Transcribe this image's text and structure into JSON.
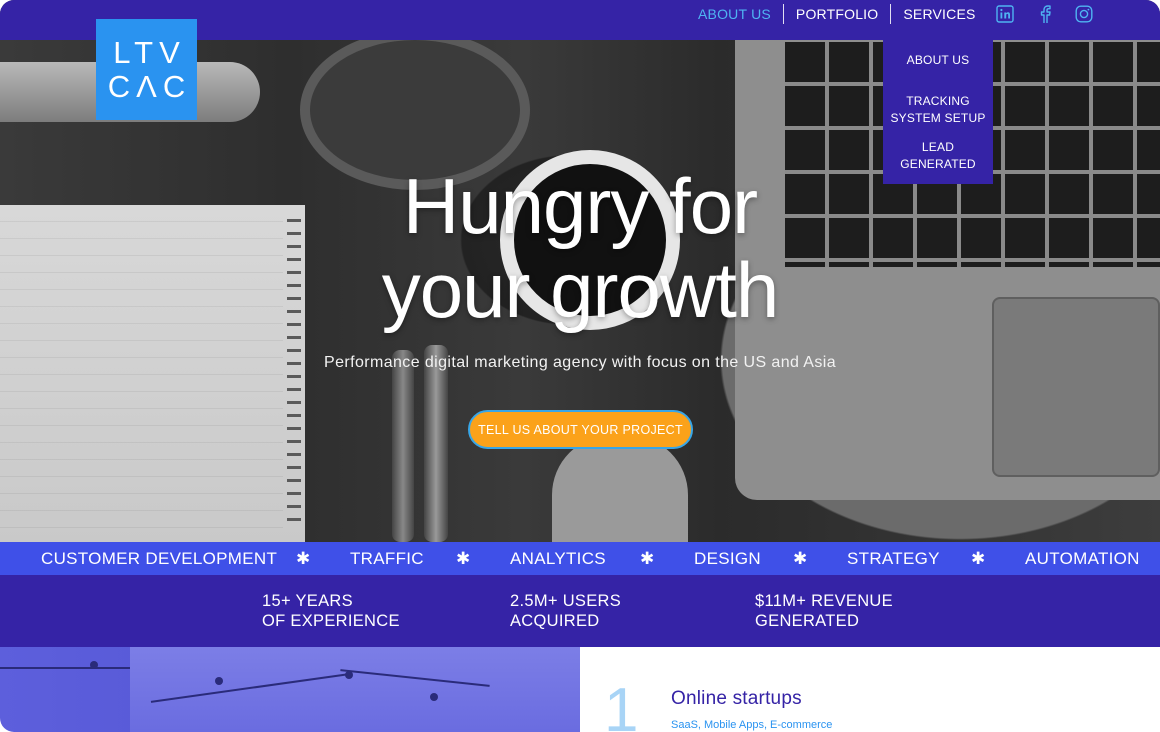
{
  "nav": {
    "items": [
      {
        "label": "ABOUT US",
        "active": true
      },
      {
        "label": "PORTFOLIO",
        "active": false
      },
      {
        "label": "SERVICES",
        "active": false
      }
    ],
    "social": [
      "linkedin-icon",
      "facebook-icon",
      "instagram-icon"
    ]
  },
  "logo": {
    "line1": "LTV",
    "line2": "CΛC"
  },
  "dropdown": {
    "items": [
      {
        "line1": "ABOUT US",
        "line2": ""
      },
      {
        "line1": "TRACKING",
        "line2": "SYSTEM SETUP"
      },
      {
        "line1": "LEAD",
        "line2": "GENERATED"
      }
    ]
  },
  "hero": {
    "title_line1": "Hungry for",
    "title_line2": "your growth",
    "subtitle": "Performance digital marketing agency with focus on the US and Asia",
    "cta": "TELL US ABOUT YOUR PROJECT"
  },
  "ticker": {
    "items": [
      "CUSTOMER DEVELOPMENT",
      "TRAFFIC",
      "ANALYTICS",
      "DESIGN",
      "STRATEGY",
      "AUTOMATION"
    ],
    "separator": "✱"
  },
  "stats": [
    {
      "line1": "15+ YEARS",
      "line2": "OF EXPERIENCE"
    },
    {
      "line1": "2.5M+ USERS",
      "line2": "ACQUIRED"
    },
    {
      "line1": "$11M+ REVENUE",
      "line2": "GENERATED"
    }
  ],
  "section": {
    "number": "1",
    "title": "Online startups",
    "subtitle": "SaaS, Mobile Apps, E-commerce"
  },
  "colors": {
    "primary": "#3523a6",
    "accent_blue": "#2a93f0",
    "ticker_blue": "#3f50e8",
    "cta_orange": "#fba21a",
    "active_nav": "#4fb4f2"
  }
}
